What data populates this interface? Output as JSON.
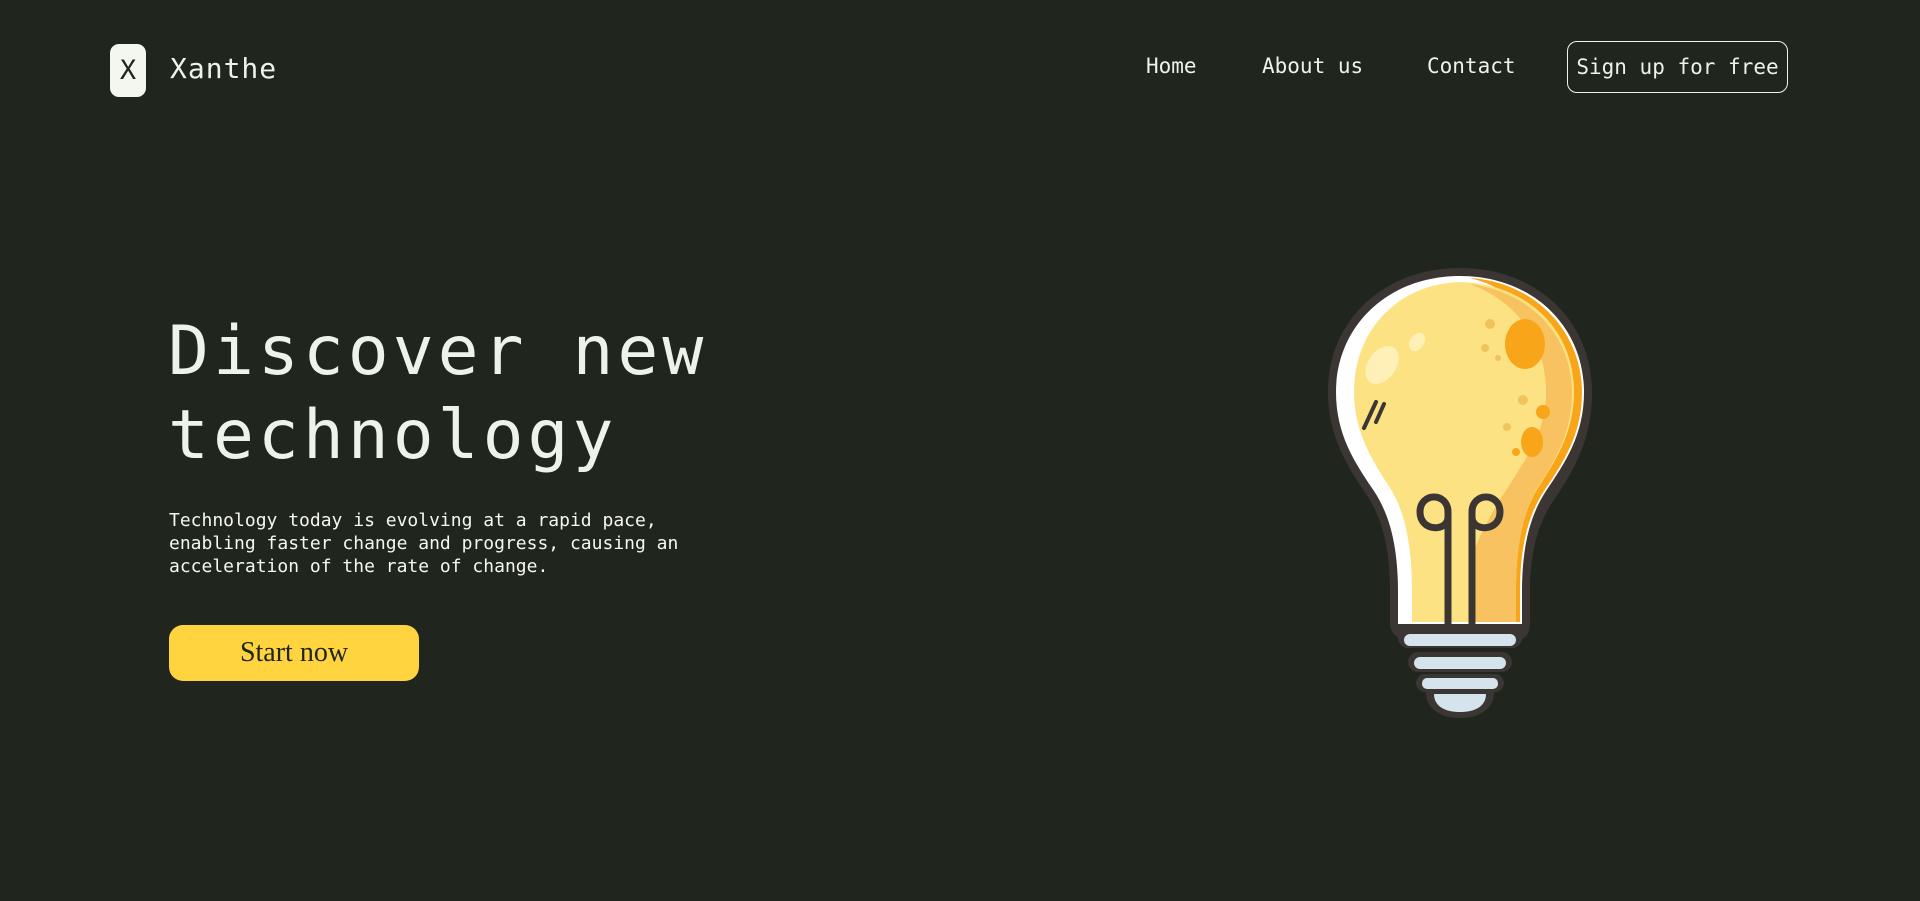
{
  "header": {
    "logo_letter": "X",
    "brand": "Xanthe",
    "nav": {
      "home": "Home",
      "about": "About us",
      "contact": "Contact"
    },
    "signup_label": "Sign up for free"
  },
  "hero": {
    "title_line1": "Discover new",
    "title_line2": "technology",
    "description": "Technology today is evolving at a rapid pace, enabling faster change and progress, causing an acceleration of the rate of change.",
    "cta_label": "Start now"
  },
  "illustration": {
    "icon": "lightbulb-illustration"
  },
  "colors": {
    "background": "#20261d",
    "text": "#eef3ea",
    "accent": "#ffd43e",
    "bulb_glass": "#fde283",
    "bulb_shade": "#f9c260",
    "bulb_orange": "#f8a51a",
    "bulb_outline": "#3b3634",
    "bulb_base": "#d4e3ec"
  }
}
